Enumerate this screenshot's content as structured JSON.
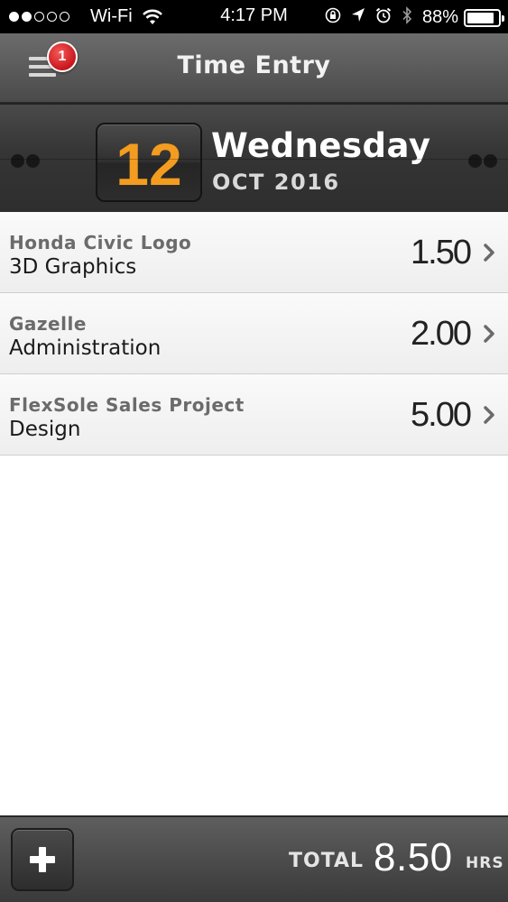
{
  "status_bar": {
    "carrier": "Wi-Fi",
    "time": "4:17 PM",
    "battery_percent": "88%",
    "battery_level": 0.88,
    "signal_bars_filled": 2,
    "signal_bars_total": 5,
    "icons": [
      "wifi-icon",
      "orientation-lock-icon",
      "location-icon",
      "alarm-icon",
      "bluetooth-icon",
      "battery-icon"
    ]
  },
  "nav": {
    "title": "Time Entry",
    "menu_badge_count": "1",
    "menu_icon": "hamburger-menu-icon"
  },
  "date": {
    "day": "12",
    "weekday": "Wednesday",
    "month_year": "OCT 2016"
  },
  "entries": [
    {
      "project": "Honda Civic Logo",
      "task": "3D Graphics",
      "hours": "1.50"
    },
    {
      "project": "Gazelle",
      "task": "Administration",
      "hours": "2.00"
    },
    {
      "project": "FlexSole Sales Project",
      "task": "Design",
      "hours": "5.00"
    }
  ],
  "footer": {
    "total_label": "TOTAL",
    "total_value": "8.50",
    "total_unit": "HRS",
    "add_icon": "plus-icon"
  },
  "colors": {
    "accent_day": "#f39c20",
    "badge": "#d0191e",
    "header_dark": "#353535"
  }
}
